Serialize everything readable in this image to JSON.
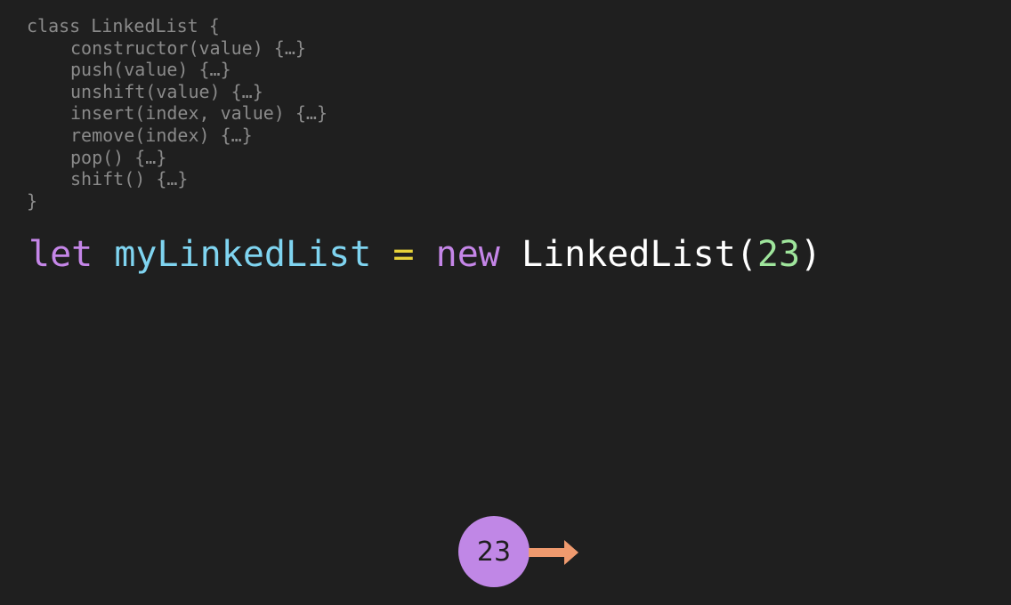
{
  "code": {
    "class_open": "class LinkedList {",
    "methods": [
      "constructor(value) {…}",
      "push(value) {…}",
      "unshift(value) {…}",
      "insert(index, value) {…}",
      "remove(index) {…}",
      "pop() {…}",
      "shift() {…}"
    ],
    "class_close": "}"
  },
  "statement": {
    "kw_let": "let",
    "var_name": "myLinkedList",
    "op": "=",
    "kw_new": "new",
    "class_name": "LinkedList",
    "paren_open": "(",
    "arg": "23",
    "paren_close": ")"
  },
  "diagram": {
    "node_value": "23",
    "colors": {
      "node": "#c087e6",
      "arrow": "#ef9a6e"
    }
  },
  "colors": {
    "background": "#1f1f1f",
    "comment_code": "#8a8a8a",
    "keyword": "#c586e8",
    "variable": "#7fd4f0",
    "operator": "#e6d23a",
    "number": "#9fe59c",
    "default": "#ffffff"
  }
}
